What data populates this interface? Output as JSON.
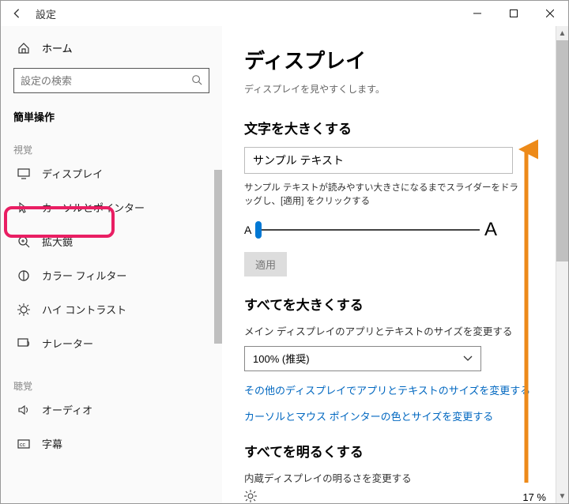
{
  "window": {
    "title": "設定",
    "min": "—",
    "max": "☐",
    "close": "✕"
  },
  "sidebar": {
    "home": "ホーム",
    "search_placeholder": "設定の検索",
    "category": "簡単操作",
    "section_visual": "視覚",
    "section_audio": "聴覚",
    "items": [
      {
        "label": "ディスプレイ",
        "icon": "display-icon"
      },
      {
        "label": "カーソルとポインター",
        "icon": "cursor-icon"
      },
      {
        "label": "拡大鏡",
        "icon": "magnifier-icon"
      },
      {
        "label": "カラー フィルター",
        "icon": "color-filter-icon"
      },
      {
        "label": "ハイ コントラスト",
        "icon": "contrast-icon"
      },
      {
        "label": "ナレーター",
        "icon": "narrator-icon"
      }
    ],
    "audio_items": [
      {
        "label": "オーディオ",
        "icon": "audio-icon"
      },
      {
        "label": "字幕",
        "icon": "caption-icon"
      }
    ]
  },
  "page": {
    "title": "ディスプレイ",
    "subtitle": "ディスプレイを見やすくします。",
    "text_bigger": {
      "heading": "文字を大きくする",
      "sample": "サンプル テキスト",
      "desc": "サンプル テキストが読みやすい大きさになるまでスライダーをドラッグし、[適用] をクリックする",
      "small_a": "A",
      "big_a": "A",
      "apply": "適用"
    },
    "everything_bigger": {
      "heading": "すべてを大きくする",
      "desc": "メイン ディスプレイのアプリとテキストのサイズを変更する",
      "dropdown": "100% (推奨)",
      "link1": "その他のディスプレイでアプリとテキストのサイズを変更する",
      "link2": "カーソルとマウス ポインターの色とサイズを変更する"
    },
    "brighter": {
      "heading": "すべてを明るくする",
      "desc": "内蔵ディスプレイの明るさを変更する",
      "pct": "17 %"
    }
  }
}
